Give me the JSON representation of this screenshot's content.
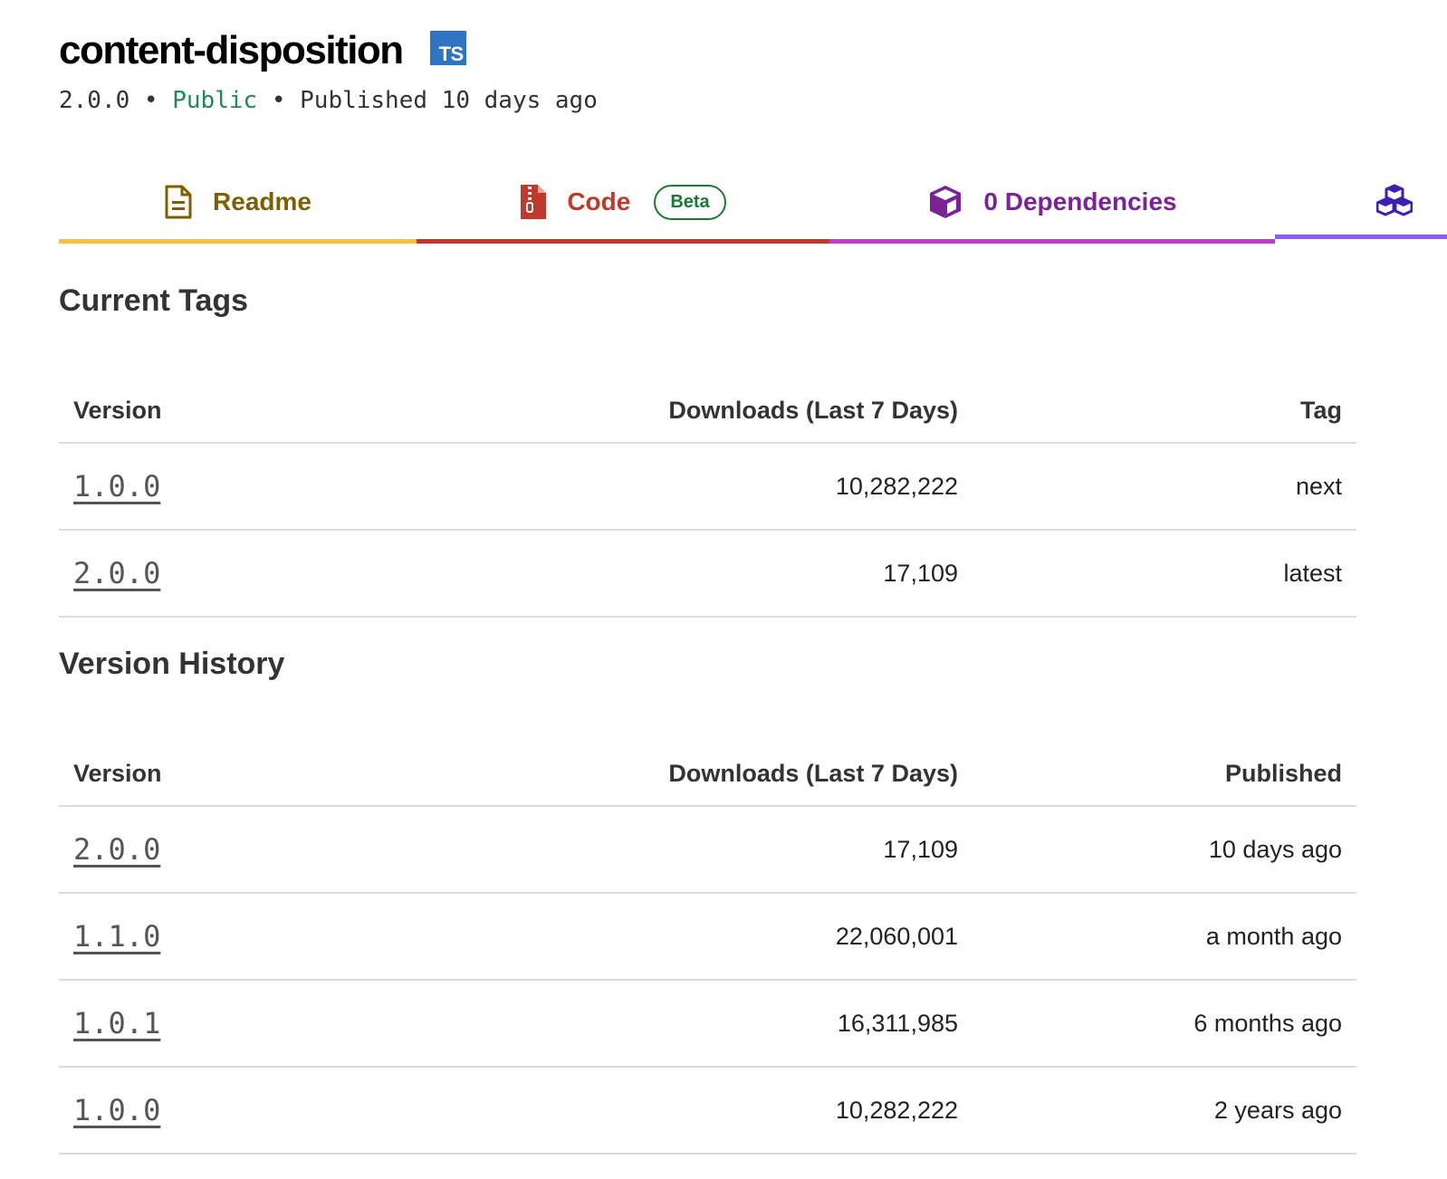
{
  "package": {
    "name": "content-disposition",
    "ts_badge": "TS",
    "version": "2.0.0",
    "separator": " • ",
    "visibility": "Public",
    "published": "Published 10 days ago"
  },
  "tabs": [
    {
      "label": "Readme",
      "icon": "readme-doc-icon",
      "color": "#7d5e00",
      "underline": "#f5c342"
    },
    {
      "label": "Code",
      "icon": "zip-file-icon",
      "color": "#c0392b",
      "underline": "#c0392b",
      "badge": "Beta"
    },
    {
      "label": "0 Dependencies",
      "icon": "package-cube-icon",
      "color": "#7a2296",
      "underline": "#c13cc7"
    },
    {
      "label": "",
      "icon": "dependents-cubes-icon",
      "color": "#3d1fb3",
      "underline": "#8d5cf6"
    }
  ],
  "current_tags": {
    "title": "Current Tags",
    "headers": [
      "Version",
      "Downloads (Last 7 Days)",
      "Tag"
    ],
    "rows": [
      {
        "version": "1.0.0",
        "downloads": "10,282,222",
        "tag": "next"
      },
      {
        "version": "2.0.0",
        "downloads": "17,109",
        "tag": "latest"
      }
    ]
  },
  "version_history": {
    "title": "Version History",
    "headers": [
      "Version",
      "Downloads (Last 7 Days)",
      "Published"
    ],
    "rows": [
      {
        "version": "2.0.0",
        "downloads": "17,109",
        "published": "10 days ago"
      },
      {
        "version": "1.1.0",
        "downloads": "22,060,001",
        "published": "a month ago"
      },
      {
        "version": "1.0.1",
        "downloads": "16,311,985",
        "published": "6 months ago"
      },
      {
        "version": "1.0.0",
        "downloads": "10,282,222",
        "published": "2 years ago"
      }
    ]
  }
}
